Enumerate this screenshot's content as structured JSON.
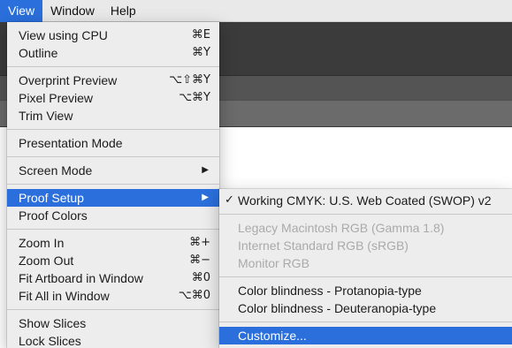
{
  "menubar": {
    "items": [
      {
        "label": "View",
        "active": true
      },
      {
        "label": "Window",
        "active": false
      },
      {
        "label": "Help",
        "active": false
      }
    ]
  },
  "view_menu": {
    "groups": [
      [
        {
          "label": "View using CPU",
          "shortcut": "⌘E"
        },
        {
          "label": "Outline",
          "shortcut": "⌘Y"
        }
      ],
      [
        {
          "label": "Overprint Preview",
          "shortcut": "⌥⇧⌘Y"
        },
        {
          "label": "Pixel Preview",
          "shortcut": "⌥⌘Y"
        },
        {
          "label": "Trim View",
          "shortcut": ""
        }
      ],
      [
        {
          "label": "Presentation Mode",
          "shortcut": ""
        }
      ],
      [
        {
          "label": "Screen Mode",
          "submenu_arrow": "▶"
        }
      ],
      [
        {
          "label": "Proof Setup",
          "submenu_arrow": "▶",
          "highlighted": true
        },
        {
          "label": "Proof Colors",
          "shortcut": ""
        }
      ],
      [
        {
          "label": "Zoom In",
          "shortcut": "⌘+"
        },
        {
          "label": "Zoom Out",
          "shortcut": "⌘−"
        },
        {
          "label": "Fit Artboard in Window",
          "shortcut": "⌘0"
        },
        {
          "label": "Fit All in Window",
          "shortcut": "⌥⌘0"
        }
      ],
      [
        {
          "label": "Show Slices",
          "shortcut": ""
        },
        {
          "label": "Lock Slices",
          "shortcut": ""
        }
      ]
    ]
  },
  "proof_menu": {
    "groups": [
      [
        {
          "label": "Working CMYK: U.S. Web Coated (SWOP) v2",
          "checked": true,
          "check_glyph": "✓",
          "enabled": true
        }
      ],
      [
        {
          "label": "Legacy Macintosh RGB (Gamma 1.8)",
          "enabled": false
        },
        {
          "label": "Internet Standard RGB (sRGB)",
          "enabled": false
        },
        {
          "label": "Monitor RGB",
          "enabled": false
        }
      ],
      [
        {
          "label": "Color blindness - Protanopia-type",
          "enabled": true
        },
        {
          "label": "Color blindness - Deuteranopia-type",
          "enabled": true
        }
      ],
      [
        {
          "label": "Customize...",
          "enabled": true,
          "highlighted": true
        }
      ]
    ]
  },
  "colors": {
    "highlight": "#2a6fdb",
    "menu_bg": "#ededed",
    "disabled_text": "#aaaaaa"
  }
}
